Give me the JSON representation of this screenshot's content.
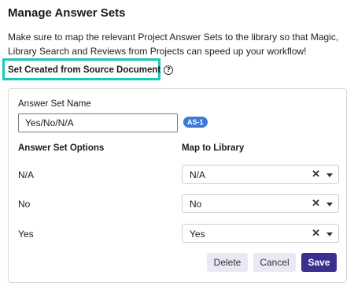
{
  "header": {
    "title": "Manage Answer Sets",
    "description": "Make sure to map the relevant Project Answer Sets to the library so that Magic, Library Search and Reviews from Projects can speed up your workflow!"
  },
  "section": {
    "label": "Set Created from Source Document",
    "help_icon": "?"
  },
  "form": {
    "name_label": "Answer Set Name",
    "name_value": "Yes/No/N/A",
    "badge": "AS-1",
    "options_header": "Answer Set Options",
    "map_header": "Map to Library",
    "rows": [
      {
        "option": "N/A",
        "mapped": "N/A"
      },
      {
        "option": "No",
        "mapped": "No"
      },
      {
        "option": "Yes",
        "mapped": "Yes"
      }
    ],
    "clear_glyph": "✕"
  },
  "buttons": {
    "delete": "Delete",
    "cancel": "Cancel",
    "save": "Save"
  },
  "colors": {
    "highlight": "#19c9b9",
    "primary": "#3b2f8f",
    "badge": "#3b7ad9"
  }
}
